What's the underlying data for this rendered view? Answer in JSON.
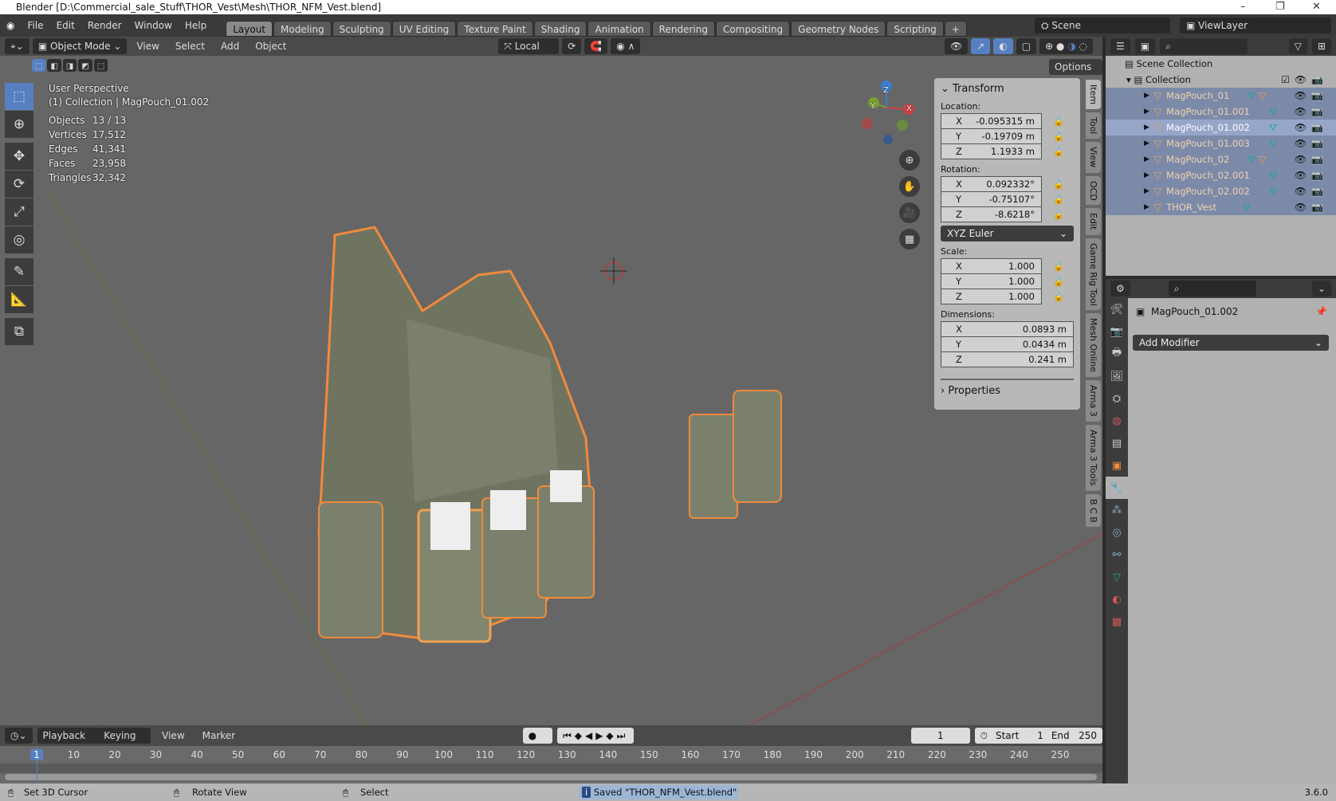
{
  "window": {
    "title": "Blender [D:\\Commercial_sale_Stuff\\THOR_Vest\\Mesh\\THOR_NFM_Vest.blend]",
    "minimize": "–",
    "restore": "❐",
    "close": "✕"
  },
  "menu": [
    "File",
    "Edit",
    "Render",
    "Window",
    "Help"
  ],
  "workspaces": [
    "Layout",
    "Modeling",
    "Sculpting",
    "UV Editing",
    "Texture Paint",
    "Shading",
    "Animation",
    "Rendering",
    "Compositing",
    "Geometry Nodes",
    "Scripting",
    "+"
  ],
  "active_workspace": "Layout",
  "scene": {
    "label": "Scene",
    "view_layer": "ViewLayer"
  },
  "viewport_header": {
    "mode": "Object Mode",
    "menus": [
      "View",
      "Select",
      "Add",
      "Object"
    ],
    "orientation": "Local",
    "options": "Options"
  },
  "overlay": {
    "view_name": "User Perspective",
    "context": "(1) Collection | MagPouch_01.002",
    "stats": [
      {
        "label": "Objects",
        "value": "13 / 13"
      },
      {
        "label": "Vertices",
        "value": "17,512"
      },
      {
        "label": "Edges",
        "value": "41,341"
      },
      {
        "label": "Faces",
        "value": "23,958"
      },
      {
        "label": "Triangles",
        "value": "32,342"
      }
    ]
  },
  "gizmo": {
    "x": "X",
    "y": "Y",
    "z": "Z"
  },
  "transform": {
    "title": "Transform",
    "location_label": "Location:",
    "location": [
      {
        "axis": "X",
        "value": "-0.095315 m"
      },
      {
        "axis": "Y",
        "value": "-0.19709 m"
      },
      {
        "axis": "Z",
        "value": "1.1933 m"
      }
    ],
    "rotation_label": "Rotation:",
    "rotation": [
      {
        "axis": "X",
        "value": "0.092332°"
      },
      {
        "axis": "Y",
        "value": "-0.75107°"
      },
      {
        "axis": "Z",
        "value": "-8.6218°"
      }
    ],
    "rotation_mode": "XYZ Euler",
    "scale_label": "Scale:",
    "scale": [
      {
        "axis": "X",
        "value": "1.000"
      },
      {
        "axis": "Y",
        "value": "1.000"
      },
      {
        "axis": "Z",
        "value": "1.000"
      }
    ],
    "dimensions_label": "Dimensions:",
    "dimensions": [
      {
        "axis": "X",
        "value": "0.0893 m"
      },
      {
        "axis": "Y",
        "value": "0.0434 m"
      },
      {
        "axis": "Z",
        "value": "0.241 m"
      }
    ],
    "properties_label": "Properties"
  },
  "side_tabs": [
    "Item",
    "Tool",
    "View",
    "OCD",
    "Edit",
    "Game Rig Tool",
    "Mesh Online",
    "Arma 3",
    "Arma 3 Tools",
    "B C B"
  ],
  "outliner": {
    "scene_collection": "Scene Collection",
    "collection": "Collection",
    "items": [
      {
        "name": "MagPouch_01",
        "active": false
      },
      {
        "name": "MagPouch_01.001",
        "active": false
      },
      {
        "name": "MagPouch_01.002",
        "active": true
      },
      {
        "name": "MagPouch_01.003",
        "active": false
      },
      {
        "name": "MagPouch_02",
        "active": false
      },
      {
        "name": "MagPouch_02.001",
        "active": false
      },
      {
        "name": "MagPouch_02.002",
        "active": false
      },
      {
        "name": "THOR_Vest",
        "active": false
      }
    ]
  },
  "properties": {
    "object_name": "MagPouch_01.002",
    "add_modifier": "Add Modifier"
  },
  "timeline": {
    "menus": [
      "Playback",
      "Keying",
      "View",
      "Marker"
    ],
    "current_frame": "1",
    "start_label": "Start",
    "start": "1",
    "end_label": "End",
    "end": "250",
    "ticks": [
      "1",
      "10",
      "20",
      "30",
      "40",
      "50",
      "60",
      "70",
      "80",
      "90",
      "100",
      "110",
      "120",
      "130",
      "140",
      "150",
      "160",
      "170",
      "180",
      "190",
      "200",
      "210",
      "220",
      "230",
      "240",
      "250"
    ]
  },
  "status": {
    "left": "Set 3D Cursor",
    "middle": "Rotate View",
    "right": "Select",
    "message": "Saved \"THOR_NFM_Vest.blend\"",
    "version": "3.6.0"
  },
  "colors": {
    "accent": "#5680c2",
    "selection_outline": "#f08a3c",
    "x_axis": "#d04040",
    "y_axis": "#7aa030",
    "z_axis": "#3a7fd0"
  }
}
